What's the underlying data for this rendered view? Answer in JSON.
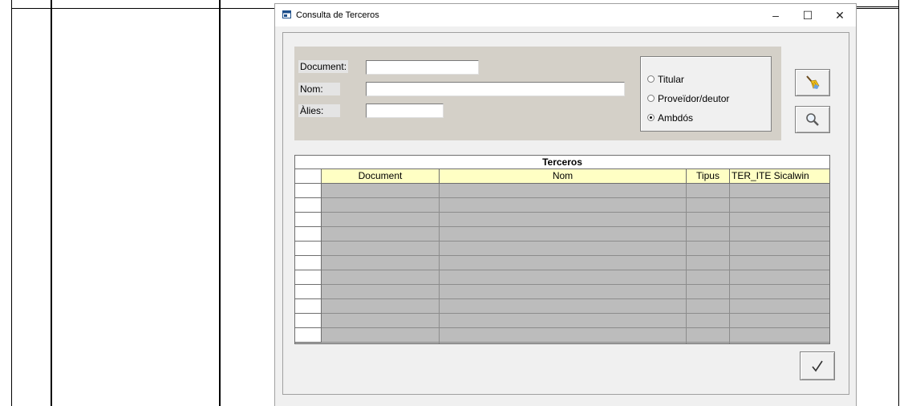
{
  "window": {
    "title": "Consulta de Terceros",
    "minimize_glyph": "–",
    "maximize_glyph": "☐",
    "close_glyph": "✕"
  },
  "search": {
    "document_label": "Document:",
    "document_value": "",
    "nom_label": "Nom:",
    "nom_value": "",
    "alies_label": "Àlies:",
    "alies_value": ""
  },
  "type_filter": {
    "options": [
      {
        "label": "Titular",
        "selected": false
      },
      {
        "label": "Proveïdor/deutor",
        "selected": false
      },
      {
        "label": "Ambdós",
        "selected": true
      }
    ]
  },
  "toolbar": {
    "clear_icon": "broom-icon",
    "search_icon": "magnifier-icon",
    "ok_icon": "checkmark-icon"
  },
  "grid": {
    "title": "Terceros",
    "columns": [
      "Document",
      "Nom",
      "Tipus",
      "TER_ITE Sicalwin"
    ],
    "row_count": 11,
    "cell_color": "#bcbcbc",
    "header_color": "#ffffc4"
  }
}
